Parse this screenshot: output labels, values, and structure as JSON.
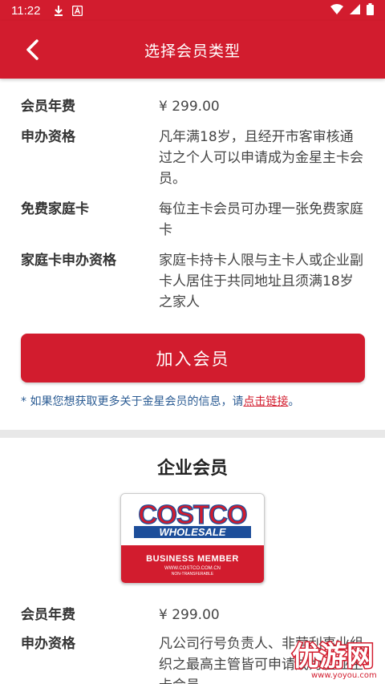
{
  "status_bar": {
    "time": "11:22",
    "icons": [
      "download-icon",
      "a-icon",
      "wifi-icon",
      "signal-icon",
      "battery-icon"
    ]
  },
  "app_bar": {
    "title": "选择会员类型",
    "back_icon": "chevron-left-icon"
  },
  "gold_star": {
    "rows": [
      {
        "label": "会员年费",
        "value": "¥ 299.00"
      },
      {
        "label": "申办资格",
        "value": "凡年满18岁，且经开市客审核通过之个人可以申请成为金星主卡会员。"
      },
      {
        "label": "免费家庭卡",
        "value": "每位主卡会员可办理一张免费家庭卡"
      },
      {
        "label": "家庭卡申办资格",
        "value": "家庭卡持卡人限与主卡人或企业副卡人居住于共同地址且须满18岁之家人"
      }
    ],
    "join_button": "加入会员",
    "note_prefix": "* 如果您想获取更多关于金星会员的信息，请",
    "note_link": "点击链接",
    "note_suffix": "。"
  },
  "business": {
    "title": "企业会员",
    "card": {
      "brand_top": "COSTCO",
      "brand_bottom": "WHOLESALE",
      "type": "BUSINESS MEMBER",
      "url": "WWW.COSTCO.COM.CN",
      "note": "NON-TRANSFERABLE"
    },
    "rows": [
      {
        "label": "会员年费",
        "value": "¥ 299.00"
      },
      {
        "label": "申办资格",
        "value": "凡公司行号负责人、非营利事业组织之最高主管皆可申请成为企业主卡会员"
      }
    ]
  },
  "watermark": {
    "text": "优游网",
    "url": "www.yoyou.com"
  },
  "colors": {
    "primary": "#d21c2e",
    "note_blue": "#2a5b93",
    "costco_blue": "#1d4e9a"
  }
}
